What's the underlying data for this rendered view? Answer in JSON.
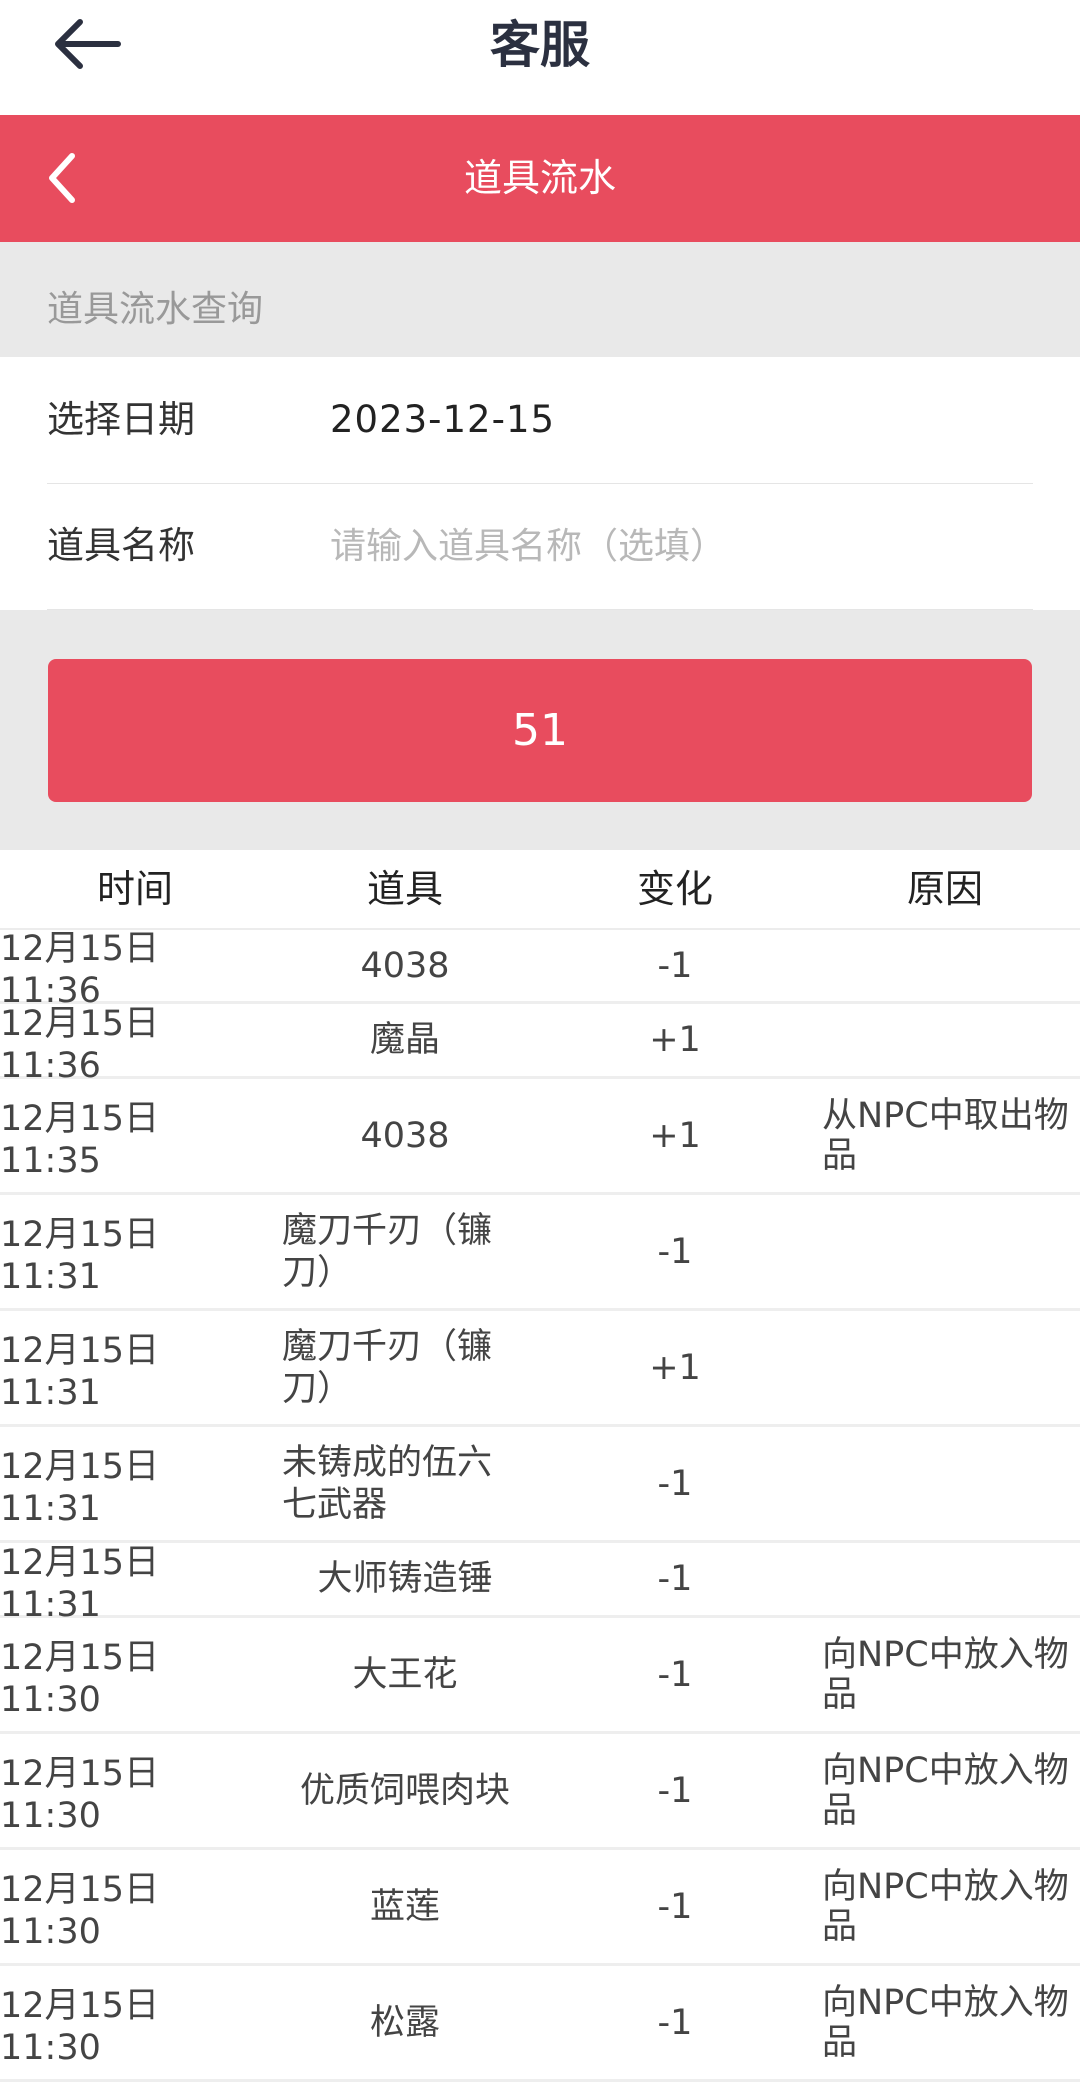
{
  "header": {
    "title": "客服"
  },
  "subheader": {
    "title": "道具流水"
  },
  "query": {
    "section_title": "道具流水查询",
    "date_label": "选择日期",
    "date_value": "2023-12-15",
    "item_label": "道具名称",
    "item_placeholder": "请输入道具名称（选填）",
    "submit_label": "51"
  },
  "table": {
    "columns": [
      "时间",
      "道具",
      "变化",
      "原因"
    ],
    "rows": [
      {
        "time": "12月15日 11:36",
        "item": "4038",
        "change": "-1",
        "reason": ""
      },
      {
        "time": "12月15日 11:36",
        "item": "魔晶",
        "change": "+1",
        "reason": ""
      },
      {
        "time": "12月15日 11:35",
        "item": "4038",
        "change": "+1",
        "reason": "从NPC中取出物品"
      },
      {
        "time": "12月15日 11:31",
        "item": "魔刀千刃（镰刀）",
        "change": "-1",
        "reason": ""
      },
      {
        "time": "12月15日 11:31",
        "item": "魔刀千刃（镰刀）",
        "change": "+1",
        "reason": ""
      },
      {
        "time": "12月15日 11:31",
        "item": "未铸成的伍六七武器",
        "change": "-1",
        "reason": ""
      },
      {
        "time": "12月15日 11:31",
        "item": "大师铸造锤",
        "change": "-1",
        "reason": ""
      },
      {
        "time": "12月15日 11:30",
        "item": "大王花",
        "change": "-1",
        "reason": "向NPC中放入物品"
      },
      {
        "time": "12月15日 11:30",
        "item": "优质饲喂肉块",
        "change": "-1",
        "reason": "向NPC中放入物品"
      },
      {
        "time": "12月15日 11:30",
        "item": "蓝莲",
        "change": "-1",
        "reason": "向NPC中放入物品"
      },
      {
        "time": "12月15日 11:30",
        "item": "松露",
        "change": "-1",
        "reason": "向NPC中放入物品"
      }
    ]
  },
  "colors": {
    "accent": "#e84c5e",
    "panel": "#e9e9e9"
  }
}
